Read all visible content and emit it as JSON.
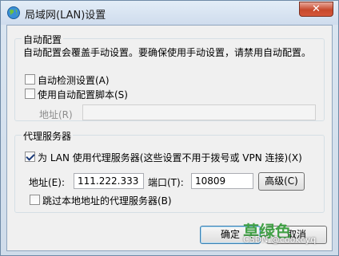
{
  "window": {
    "title": "局域网(LAN)设置",
    "close_label": "✕"
  },
  "auto_config": {
    "group_title": "自动配置",
    "description": "自动配置会覆盖手动设置。要确保使用手动设置，请禁用自动配置。",
    "auto_detect_label": "自动检测设置(A)",
    "auto_detect_checked": false,
    "use_script_label": "使用自动配置脚本(S)",
    "use_script_checked": false,
    "address_label": "地址(R)",
    "address_value": ""
  },
  "proxy": {
    "group_title": "代理服务器",
    "use_proxy_label": "为 LAN 使用代理服务器(这些设置不用于拨号或 VPN 连接)(X)",
    "use_proxy_checked": true,
    "address_label": "地址(E):",
    "address_value": "111.222.333",
    "port_label": "端口(T):",
    "port_value": "10809",
    "advanced_label": "高级(C)",
    "bypass_label": "跳过本地地址的代理服务器(B)",
    "bypass_checked": false
  },
  "footer": {
    "ok_label": "确定",
    "cancel_label": "取消"
  },
  "watermark": {
    "text1": "草绿色",
    "text2": "CSDN @cookcyq"
  }
}
